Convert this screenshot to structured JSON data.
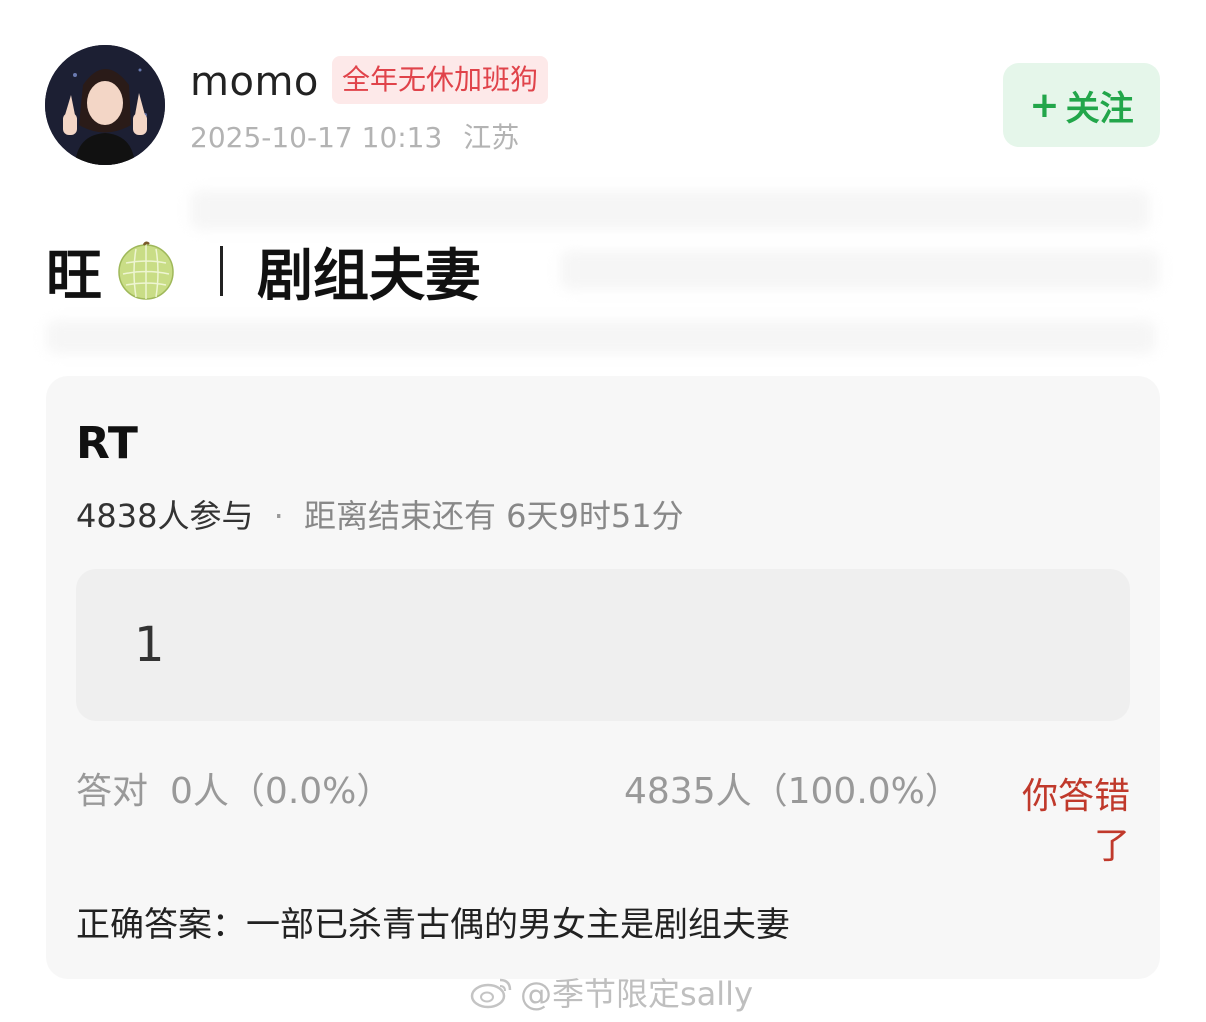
{
  "header": {
    "username": "momo",
    "badge": "全年无休加班狗",
    "timestamp": "2025-10-17 10:13",
    "location": "江苏",
    "follow_label": "关注",
    "follow_plus": "+"
  },
  "post": {
    "title_prefix": "旺",
    "title_main": "剧组夫妻"
  },
  "quiz": {
    "title": "RT",
    "participants": "4838人参与",
    "separator": "·",
    "remaining": "距离结束还有 6天9时51分",
    "options": [
      {
        "label": "1"
      }
    ],
    "correct_label": "答对",
    "correct_count": "0人（0.0%）",
    "option_count": "4835人（100.0%）",
    "wrong_status": "你答错了",
    "answer": "正确答案：一部已杀青古偶的男女主是剧组夫妻"
  },
  "watermark": {
    "text": "@季节限定sally"
  },
  "colors": {
    "follow_green": "#22a64a",
    "badge_red": "#e0434a",
    "wrong_red": "#c0392b"
  }
}
